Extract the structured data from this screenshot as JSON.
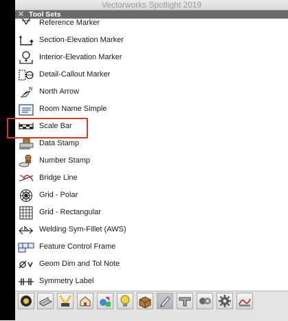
{
  "window": {
    "title": "Vectorworks Spotlight 2019"
  },
  "palette": {
    "close_glyph": "✕",
    "title": "Tool Sets"
  },
  "tools": [
    {
      "label": "Reference Marker",
      "icon": "reference-marker-icon"
    },
    {
      "label": "Section-Elevation Marker",
      "icon": "section-elevation-marker-icon"
    },
    {
      "label": "Interior-Elevation Marker",
      "icon": "interior-elevation-marker-icon"
    },
    {
      "label": "Detail-Callout Marker",
      "icon": "detail-callout-marker-icon"
    },
    {
      "label": "North Arrow",
      "icon": "north-arrow-icon"
    },
    {
      "label": "Room Name Simple",
      "icon": "room-name-icon"
    },
    {
      "label": "Scale Bar",
      "icon": "scale-bar-icon"
    },
    {
      "label": "Data Stamp",
      "icon": "data-stamp-icon"
    },
    {
      "label": "Number Stamp",
      "icon": "number-stamp-icon"
    },
    {
      "label": "Bridge Line",
      "icon": "bridge-line-icon"
    },
    {
      "label": "Grid - Polar",
      "icon": "polar-grid-icon"
    },
    {
      "label": "Grid - Rectangular",
      "icon": "rectangular-grid-icon"
    },
    {
      "label": "Welding Sym-Fillet (AWS)",
      "icon": "welding-symbol-icon"
    },
    {
      "label": "Feature Control Frame",
      "icon": "feature-control-frame-icon"
    },
    {
      "label": "Geom Dim and Tol Note",
      "icon": "geom-dim-tol-icon"
    },
    {
      "label": "Symmetry Label",
      "icon": "symmetry-label-icon"
    }
  ],
  "highlighted_tool": "Scale Bar",
  "toolset_buttons": [
    {
      "icon": "visualization-toolset-icon"
    },
    {
      "icon": "building-shell-toolset-icon"
    },
    {
      "icon": "lighting-toolset-icon"
    },
    {
      "icon": "site-planning-toolset-icon"
    },
    {
      "icon": "3d-modeling-toolset-icon"
    },
    {
      "icon": "spotlight-toolset-icon"
    },
    {
      "icon": "furniture-toolset-icon"
    },
    {
      "icon": "dims-notes-toolset-icon",
      "active": true
    },
    {
      "icon": "detailing-toolset-icon"
    },
    {
      "icon": "machine-components-toolset-icon"
    },
    {
      "icon": "mechanical-toolset-icon"
    },
    {
      "icon": "hvac-toolset-icon"
    }
  ],
  "colors": {
    "highlight_border": "#d03a28",
    "header_bg": "#6a6a6a"
  }
}
